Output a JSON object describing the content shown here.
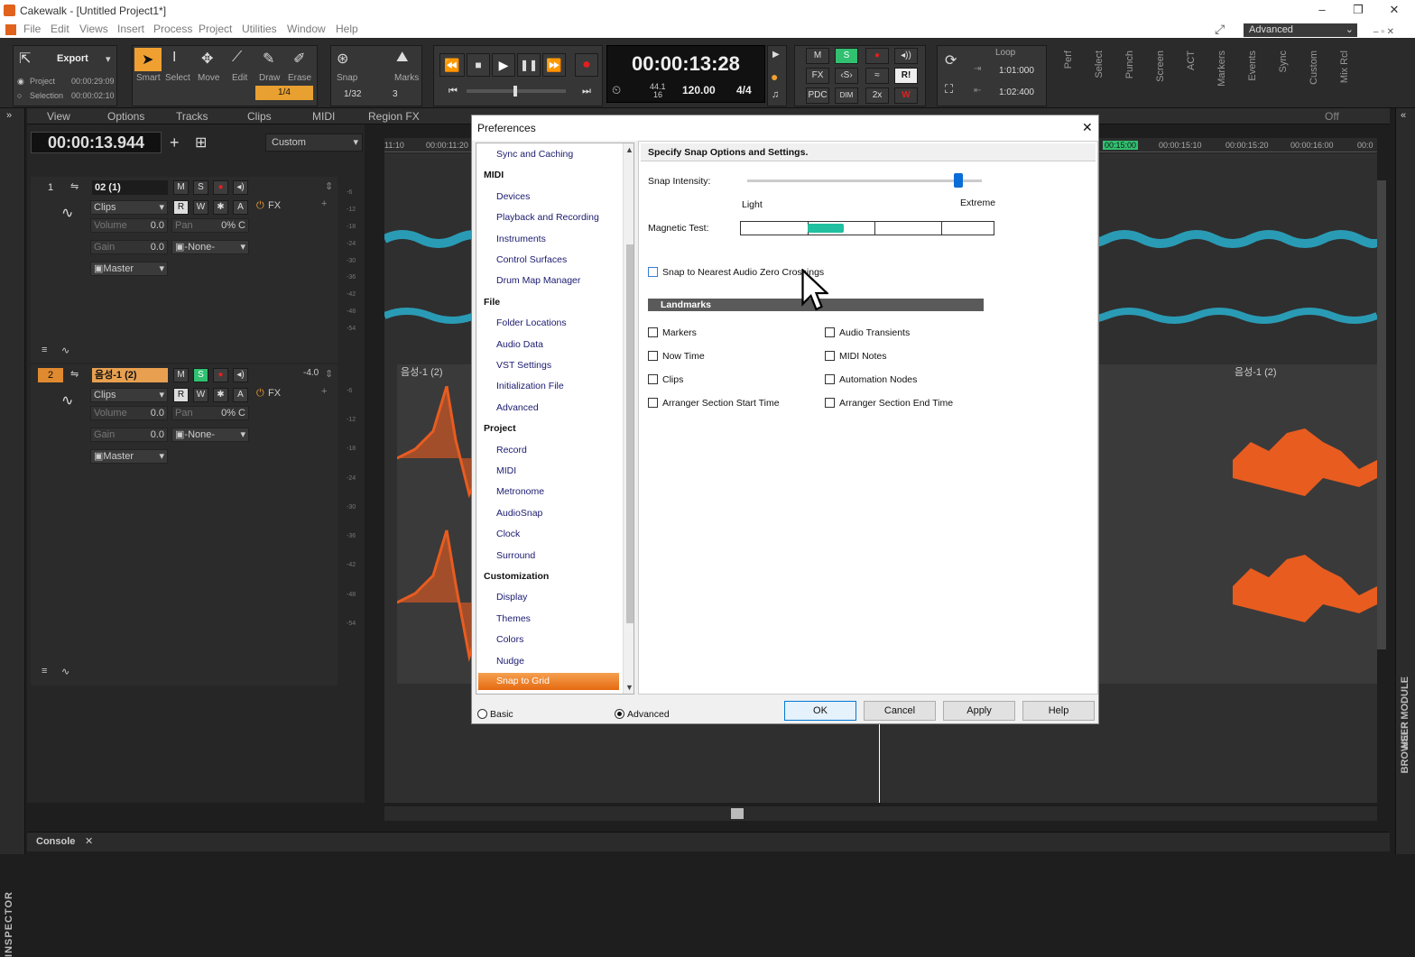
{
  "titlebar": {
    "title": "Cakewalk - [Untitled Project1*]"
  },
  "menu": [
    "File",
    "Edit",
    "Views",
    "Insert",
    "Process",
    "Project",
    "Utilities",
    "Window",
    "Help"
  ],
  "workspace": {
    "label": "Advanced"
  },
  "toolbar": {
    "export": "Export",
    "project_label": "Project",
    "project_time": "00:00:29:09",
    "selection_label": "Selection",
    "selection_time": "00:00:02:10",
    "tools": [
      "Smart",
      "Select",
      "Move",
      "Edit",
      "Draw",
      "Erase"
    ],
    "snap_label": "Snap",
    "snap_value": "1/4",
    "snap_res": "1/32",
    "marks_label": "Marks",
    "marks_value": "3",
    "clock": "00:00:13:28",
    "sample_rate": "44.1",
    "bit_depth": "16",
    "tempo": "120.00",
    "meter": "4/4",
    "mix_m": "M",
    "mix_s": "S",
    "fx": "FX",
    "pdc": "PDC",
    "dim": "DIM",
    "x2": "2x",
    "ri": "R!",
    "loop_label": "Loop",
    "loop_start": "1:01:000",
    "loop_end": "1:02:400",
    "modules": [
      "Perf",
      "Select",
      "Punch",
      "Screen",
      "ACT",
      "Markers",
      "Events",
      "Sync",
      "Custom",
      "Mix Rcl"
    ]
  },
  "view_menu": [
    "View",
    "Options",
    "Tracks",
    "Clips",
    "MIDI",
    "Region FX"
  ],
  "timeline_clock": "00:00:13.944",
  "custom_select": "Custom",
  "ruler_left": [
    "11:10",
    "00:00:11:20"
  ],
  "ruler_right": [
    "00:15:00",
    "00:00:15:10",
    "00:00:15:20",
    "00:00:16:00",
    "00:0"
  ],
  "tracks": [
    {
      "num": "1",
      "name": "02 (1)",
      "m": "M",
      "s": "S",
      "r": "R",
      "w": "W",
      "a": "A",
      "clips": "Clips",
      "fx": "FX",
      "volume_label": "Volume",
      "volume": "0.0",
      "pan_label": "Pan",
      "pan": "0% C",
      "gain_label": "Gain",
      "gain": "0.0",
      "input": "-None-",
      "output": "Master",
      "peak": ""
    },
    {
      "num": "2",
      "name": "음성-1 (2)",
      "m": "M",
      "s": "S",
      "r": "R",
      "w": "W",
      "a": "A",
      "clips": "Clips",
      "fx": "FX",
      "volume_label": "Volume",
      "volume": "0.0",
      "pan_label": "Pan",
      "pan": "0% C",
      "gain_label": "Gain",
      "gain": "0.0",
      "input": "-None-",
      "output": "Master",
      "peak": "-4.0"
    }
  ],
  "clip_labels": [
    "음성-1 (2)",
    "음성-1 (2)"
  ],
  "meter_scale": [
    "-6",
    "-12",
    "-18",
    "-24",
    "-30",
    "-36",
    "-42",
    "-48",
    "-54"
  ],
  "right_strip": [
    "BROWSER",
    "HELP MODULE"
  ],
  "left_strip": "INSPECTOR",
  "off_label": "Off",
  "console": {
    "label": "Console"
  },
  "dialog": {
    "title": "Preferences",
    "nav": [
      {
        "t": "Sync and Caching",
        "k": "c"
      },
      {
        "t": "MIDI",
        "k": "h"
      },
      {
        "t": "Devices",
        "k": "c"
      },
      {
        "t": "Playback and Recording",
        "k": "c"
      },
      {
        "t": "Instruments",
        "k": "c"
      },
      {
        "t": "Control Surfaces",
        "k": "c"
      },
      {
        "t": "Drum Map Manager",
        "k": "c"
      },
      {
        "t": "File",
        "k": "h"
      },
      {
        "t": "Folder Locations",
        "k": "c"
      },
      {
        "t": "Audio Data",
        "k": "c"
      },
      {
        "t": "VST Settings",
        "k": "c"
      },
      {
        "t": "Initialization File",
        "k": "c"
      },
      {
        "t": "Advanced",
        "k": "c"
      },
      {
        "t": "Project",
        "k": "h"
      },
      {
        "t": "Record",
        "k": "c"
      },
      {
        "t": "MIDI",
        "k": "c"
      },
      {
        "t": "Metronome",
        "k": "c"
      },
      {
        "t": "AudioSnap",
        "k": "c"
      },
      {
        "t": "Clock",
        "k": "c"
      },
      {
        "t": "Surround",
        "k": "c"
      },
      {
        "t": "Customization",
        "k": "h"
      },
      {
        "t": "Display",
        "k": "c"
      },
      {
        "t": "Themes",
        "k": "c"
      },
      {
        "t": "Colors",
        "k": "c"
      },
      {
        "t": "Nudge",
        "k": "c"
      },
      {
        "t": "Snap to Grid",
        "k": "sel"
      }
    ],
    "header": "Specify Snap Options and Settings.",
    "snap_intensity_label": "Snap Intensity:",
    "snap_intensity": 0.9,
    "light": "Light",
    "extreme": "Extreme",
    "magnetic_label": "Magnetic Test:",
    "zero_cross": "Snap to Nearest Audio Zero Crossings",
    "landmarks": "Landmarks",
    "checks_left": [
      "Markers",
      "Now Time",
      "Clips",
      "Arranger Section Start Time"
    ],
    "checks_right": [
      "Audio Transients",
      "MIDI Notes",
      "Automation Nodes",
      "Arranger Section End Time"
    ],
    "basic": "Basic",
    "advanced": "Advanced",
    "ok": "OK",
    "cancel": "Cancel",
    "apply": "Apply",
    "help": "Help"
  }
}
